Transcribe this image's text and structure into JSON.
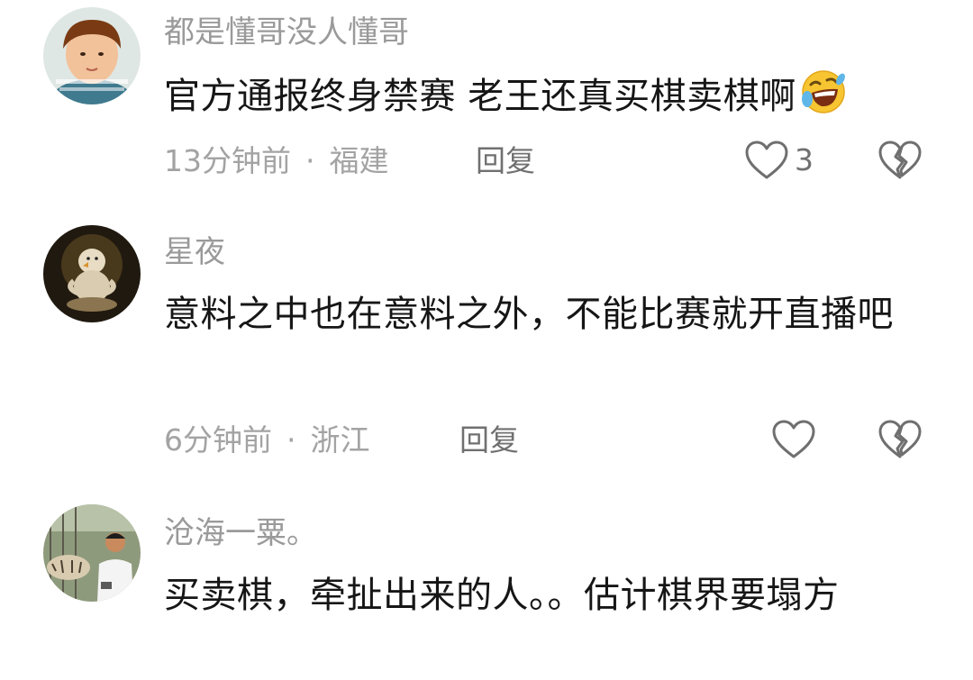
{
  "comments": [
    {
      "username": "都是懂哥没人懂哥",
      "content": "官方通报终身禁赛 老王还真买棋卖棋啊",
      "emoji": "rolling-laughing-emoji",
      "time": "13分钟前",
      "separator": "·",
      "location": "福建",
      "reply_label": "回复",
      "like_count": "3",
      "avatar_icon": "cartoon-boy-avatar"
    },
    {
      "username": "星夜",
      "content": "意料之中也在意料之外，不能比赛就开直播吧",
      "time": "6分钟前",
      "separator": "·",
      "location": "浙江",
      "reply_label": "回复",
      "like_count": "",
      "avatar_icon": "meditating-chick-avatar"
    },
    {
      "username": "沧海一粟。",
      "content": "买卖棋，牵扯出来的人。。估计棋界要塌方",
      "avatar_icon": "man-with-tiger-avatar"
    }
  ],
  "colors": {
    "username": "#9a9a9a",
    "content": "#161616",
    "meta": "#a3a3a3",
    "action": "#707070"
  }
}
